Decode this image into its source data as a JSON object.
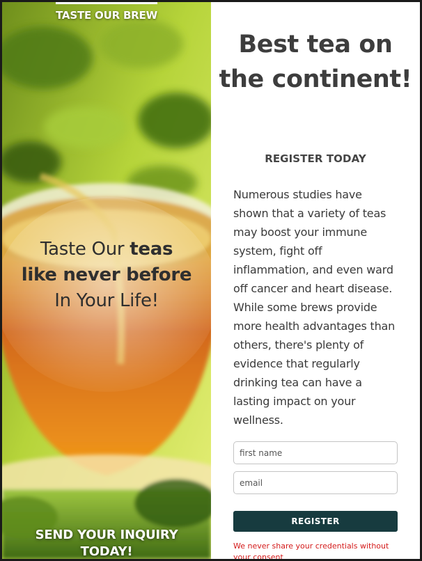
{
  "hero": {
    "top_label": "TASTE OUR BREW",
    "headline": {
      "line1_regular": "Taste Our ",
      "line1_bold": "teas",
      "line2_bold": "like never before",
      "line3_regular": "In Your Life!"
    },
    "cta_line1": "SEND YOUR INQUIRY",
    "cta_line2": "TODAY!"
  },
  "content": {
    "title": "Best tea on the continent!",
    "subheading": "REGISTER TODAY",
    "body": "Numerous studies have shown that a variety of teas may boost your immune system, fight off inflammation, and even ward off cancer and heart disease. While some brews provide more health advantages than others, there's plenty of evidence that regularly drinking tea can have a lasting impact on your wellness.",
    "form": {
      "first_name_placeholder": "first name",
      "first_name_value": "",
      "email_placeholder": "email",
      "email_value": "",
      "submit_label": "REGISTER"
    },
    "privacy_note": "We never share your credentials without your consent"
  },
  "colors": {
    "button_bg": "#173b3f",
    "title_text": "#3d3d3d",
    "privacy_text": "#d41b1b"
  }
}
